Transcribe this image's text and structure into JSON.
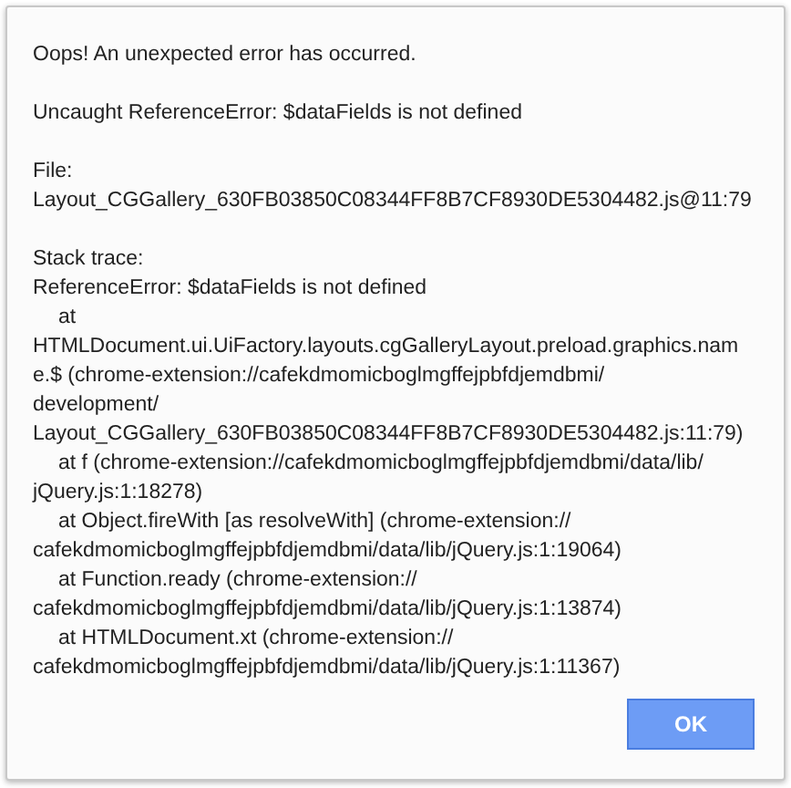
{
  "message": "Oops! An unexpected error has occurred.",
  "error": "Uncaught ReferenceError: $dataFields is not defined",
  "file": {
    "label": "File:",
    "path": "Layout_CGGallery_630FB03850C08344FF8B7CF8930DE5304482.js@11:79"
  },
  "stack_trace": {
    "label": "Stack trace:",
    "lines": [
      {
        "text": "ReferenceError: $dataFields is not defined",
        "indented": false
      },
      {
        "text": "at",
        "indented": true
      },
      {
        "text": "HTMLDocument.ui.UiFactory.layouts.cgGalleryLayout.preload.graphics.nam",
        "indented": false
      },
      {
        "text": "e.$ (chrome-extension://cafekdmomicboglmgffejpbfdjemdbmi/",
        "indented": false
      },
      {
        "text": "development/",
        "indented": false
      },
      {
        "text": "Layout_CGGallery_630FB03850C08344FF8B7CF8930DE5304482.js:11:79)",
        "indented": false
      },
      {
        "text": "at f (chrome-extension://cafekdmomicboglmgffejpbfdjemdbmi/data/lib/",
        "indented": true
      },
      {
        "text": "jQuery.js:1:18278)",
        "indented": false
      },
      {
        "text": "at Object.fireWith [as resolveWith] (chrome-extension://",
        "indented": true
      },
      {
        "text": "cafekdmomicboglmgffejpbfdjemdbmi/data/lib/jQuery.js:1:19064)",
        "indented": false
      },
      {
        "text": "at Function.ready (chrome-extension://",
        "indented": true
      },
      {
        "text": "cafekdmomicboglmgffejpbfdjemdbmi/data/lib/jQuery.js:1:13874)",
        "indented": false
      },
      {
        "text": "at HTMLDocument.xt (chrome-extension://",
        "indented": true
      },
      {
        "text": "cafekdmomicboglmgffejpbfdjemdbmi/data/lib/jQuery.js:1:11367)",
        "indented": false
      }
    ]
  },
  "button": "OK"
}
